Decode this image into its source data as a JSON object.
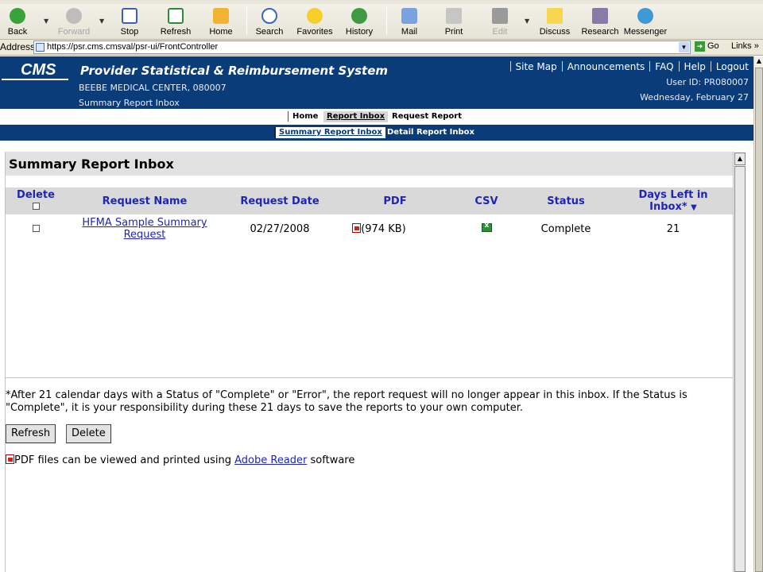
{
  "browser": {
    "toolbar": [
      {
        "label": "Back",
        "icon": "back-arrow-icon",
        "enabled": true
      },
      {
        "label": "Forward",
        "icon": "forward-arrow-icon",
        "enabled": false
      },
      {
        "label": "Stop",
        "icon": "stop-icon",
        "enabled": true
      },
      {
        "label": "Refresh",
        "icon": "refresh-icon",
        "enabled": true
      },
      {
        "label": "Home",
        "icon": "home-icon",
        "enabled": true
      },
      {
        "label": "Search",
        "icon": "search-icon",
        "enabled": true
      },
      {
        "label": "Favorites",
        "icon": "favorites-star-icon",
        "enabled": true
      },
      {
        "label": "History",
        "icon": "history-icon",
        "enabled": true
      },
      {
        "label": "Mail",
        "icon": "mail-icon",
        "enabled": true
      },
      {
        "label": "Print",
        "icon": "print-icon",
        "enabled": true
      },
      {
        "label": "Edit",
        "icon": "edit-icon",
        "enabled": false
      },
      {
        "label": "Discuss",
        "icon": "discuss-icon",
        "enabled": true
      },
      {
        "label": "Research",
        "icon": "research-icon",
        "enabled": true
      },
      {
        "label": "Messenger",
        "icon": "messenger-icon",
        "enabled": true
      }
    ],
    "address_label": "Address",
    "url": "https://psr.cms.cmsval/psr-ui/FrontController",
    "go_label": "Go",
    "links_label": "Links"
  },
  "header": {
    "logo_text": "CMS",
    "app_title": "Provider Statistical & Reimbursement System",
    "provider": "BEEBE MEDICAL CENTER, 080007",
    "page_name": "Summary Report Inbox",
    "links": [
      "Site Map",
      "Announcements",
      "FAQ",
      "Help",
      "Logout"
    ],
    "user_id": "User ID: PR080007",
    "date": "Wednesday, February 27"
  },
  "nav": {
    "home": "Home",
    "report_inbox": "Report Inbox",
    "request_report": "Request Report",
    "active": "Report Inbox"
  },
  "subnav": {
    "summary": "Summary Report Inbox",
    "detail": "Detail Report Inbox",
    "active": "Summary Report Inbox"
  },
  "inbox": {
    "title": "Summary Report Inbox",
    "columns": {
      "delete": "Delete",
      "request_name": "Request Name",
      "request_date": "Request Date",
      "pdf": "PDF",
      "csv": "CSV",
      "status": "Status",
      "days_left_line1": "Days Left in",
      "days_left_line2": "Inbox*",
      "sort_indicator": "▼"
    },
    "rows": [
      {
        "name_line1": "HFMA Sample Summary",
        "name_line2": "Request",
        "date": "02/27/2008",
        "pdf": "(974 KB)",
        "status": "Complete",
        "days_left": "21"
      }
    ],
    "footnote_line1": "*After 21 calendar days with a Status of \"Complete\" or \"Error\", the report request will no longer appear in this inbox.  If  the Status is",
    "footnote_line2": "\"Complete\", it is your responsibility during these 21 days to save the reports to your own computer.",
    "buttons": {
      "refresh": "Refresh",
      "delete": "Delete"
    },
    "pdf_note_prefix": "PDF files can be viewed and printed using ",
    "pdf_note_link": "Adobe Reader",
    "pdf_note_suffix": " software"
  },
  "colors": {
    "header_blue": "#0b3c7a",
    "link_blue": "#1f26b5",
    "column_header_bg": "#d9d9d9"
  }
}
